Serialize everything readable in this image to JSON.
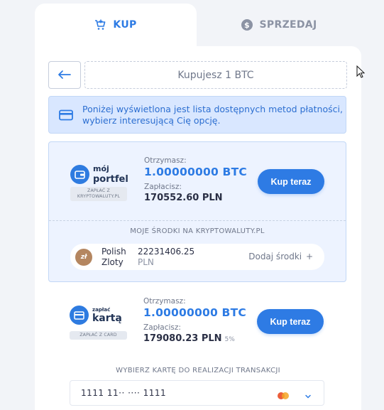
{
  "tabs": {
    "buy_label": "KUP",
    "sell_label": "SPRZEDAJ"
  },
  "header": {
    "amount_text": "Kupujesz 1 BTC"
  },
  "info": {
    "text": "Poniżej wyświetlona jest lista dostępnych metod płatności, wybierz interesującą Cię opcję."
  },
  "wallet_method": {
    "logo_line1": "mój",
    "logo_line2": "portfel",
    "badge_line1": "ZAPŁAĆ Z",
    "badge_line2": "KRYPTOWALUTY.PL",
    "receive_label": "Otrzymasz:",
    "receive_value": "1.00000000 BTC",
    "pay_label": "Zapłacisz:",
    "pay_value": "170552.60 PLN",
    "buy_label": "Kup teraz",
    "funds_title": "MOJE ŚRODKI NA KRYPTOWALUTY.PL",
    "coin_symbol": "zł",
    "currency_line1": "Polish",
    "currency_line2": "Zloty",
    "balance": "22231406.25",
    "balance_unit": "PLN",
    "add_funds": "Dodaj środki"
  },
  "card_method": {
    "logo_line1": "zapłać",
    "logo_line2": "kartą",
    "badge": "ZAPŁAĆ Z CARD",
    "receive_label": "Otrzymasz:",
    "receive_value": "1.00000000 BTC",
    "pay_label": "Zapłacisz:",
    "pay_value": "179080.23 PLN",
    "fee": "5%",
    "buy_label": "Kup teraz",
    "select_title": "WYBIERZ KARTĘ DO REALIZACJI TRANSAKCJI",
    "card_number": "1111 11·· ···· 1111"
  },
  "colors": {
    "accent": "#2d7be4",
    "info_bg": "#d9e7ff",
    "method_bg": "#edf3ff"
  },
  "icons": {
    "buy_tab": "cart-icon",
    "sell_tab": "dollar-coin-icon",
    "back": "arrow-left-icon",
    "info": "credit-card-icon",
    "card_brand": "mastercard-icon",
    "dropdown": "chevron-down-icon"
  }
}
